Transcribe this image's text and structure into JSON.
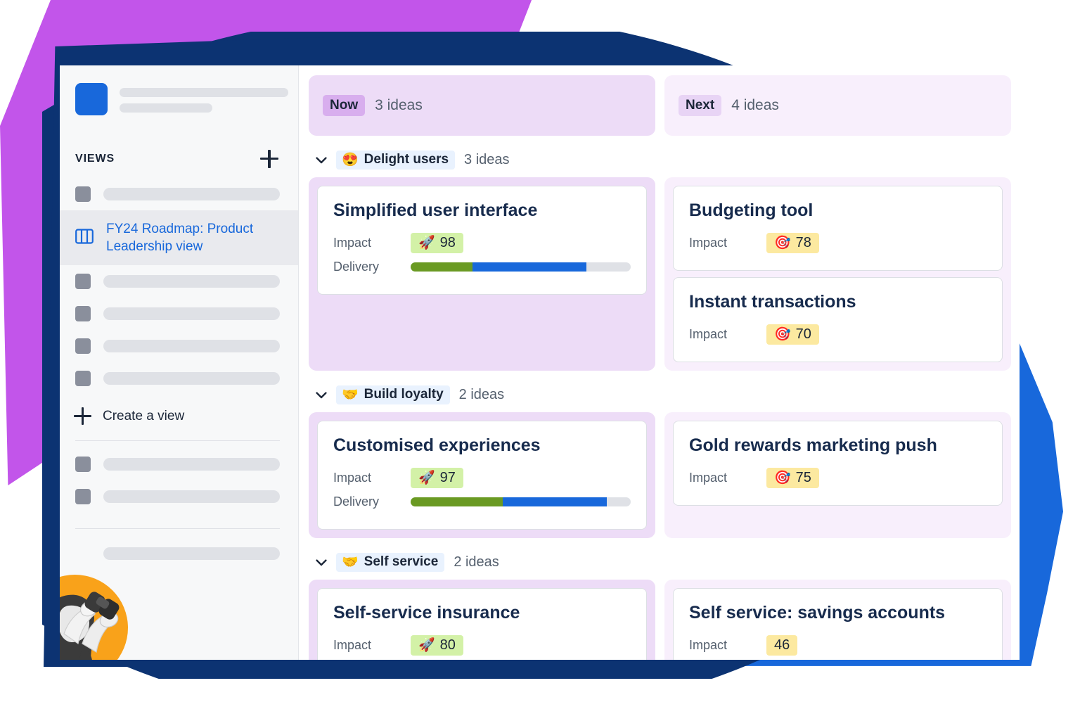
{
  "app": {
    "sidebar": {
      "views_header": "VIEWS",
      "add_view_icon": "plus-icon",
      "selected_view": {
        "label": "FY24 Roadmap: Product Leadership view",
        "icon": "board-columns-icon"
      },
      "create_view": {
        "label": "Create a view",
        "icon": "plus-icon"
      },
      "avatar": {
        "icon": "person-with-binoculars-avatar",
        "background_color": "#F9A21A"
      },
      "logo_color": "#1868DB",
      "placeholder_rows_top": 1,
      "placeholder_rows_middle": 4,
      "placeholder_rows_after_divider": 2,
      "placeholder_rows_bottom": 1
    },
    "board": {
      "columns": [
        {
          "id": "now",
          "chip": "Now",
          "count": "3 ideas",
          "header_bg": "#EDDCF7",
          "chip_bg": "#D8AEEE"
        },
        {
          "id": "next",
          "chip": "Next",
          "count": "4 ideas",
          "header_bg": "#F8EFFC",
          "chip_bg": "#E8D4F5"
        }
      ],
      "groups": [
        {
          "emoji": "😍",
          "emoji_name": "smiling-face-with-hearts-icon",
          "name": "Delight users",
          "count": "3 ideas",
          "chevron_icon": "chevron-down-icon",
          "now_cards": [
            {
              "title": "Simplified user interface",
              "impact_label": "Impact",
              "impact_value": "98",
              "impact_emoji": "🚀",
              "impact_emoji_name": "rocket-icon",
              "impact_tone": "green",
              "delivery_label": "Delivery",
              "delivery_green_pct": 28,
              "delivery_blue_pct": 52
            }
          ],
          "next_cards": [
            {
              "title": "Budgeting tool",
              "impact_label": "Impact",
              "impact_value": "78",
              "impact_emoji": "🎯",
              "impact_emoji_name": "bullseye-icon",
              "impact_tone": "yellow"
            },
            {
              "title": "Instant transactions",
              "impact_label": "Impact",
              "impact_value": "70",
              "impact_emoji": "🎯",
              "impact_emoji_name": "bullseye-icon",
              "impact_tone": "yellow"
            }
          ]
        },
        {
          "emoji": "🤝",
          "emoji_name": "handshake-icon",
          "name": "Build loyalty",
          "count": "2 ideas",
          "chevron_icon": "chevron-down-icon",
          "now_cards": [
            {
              "title": "Customised experiences",
              "impact_label": "Impact",
              "impact_value": "97",
              "impact_emoji": "🚀",
              "impact_emoji_name": "rocket-icon",
              "impact_tone": "green",
              "delivery_label": "Delivery",
              "delivery_green_pct": 42,
              "delivery_blue_pct": 47
            }
          ],
          "next_cards": [
            {
              "title": "Gold rewards marketing push",
              "impact_label": "Impact",
              "impact_value": "75",
              "impact_emoji": "🎯",
              "impact_emoji_name": "bullseye-icon",
              "impact_tone": "yellow"
            }
          ]
        },
        {
          "emoji": "🤝",
          "emoji_name": "handshake-icon",
          "name": "Self service",
          "count": "2 ideas",
          "chevron_icon": "chevron-down-icon",
          "now_cards": [
            {
              "title": "Self-service insurance",
              "impact_label": "Impact",
              "impact_value": "80",
              "impact_emoji": "🚀",
              "impact_emoji_name": "rocket-icon",
              "impact_tone": "green"
            }
          ],
          "next_cards": [
            {
              "title": "Self service: savings accounts",
              "impact_label": "Impact",
              "impact_value": "46",
              "impact_emoji": "",
              "impact_emoji_name": "none",
              "impact_tone": "yellow"
            }
          ]
        }
      ]
    }
  }
}
